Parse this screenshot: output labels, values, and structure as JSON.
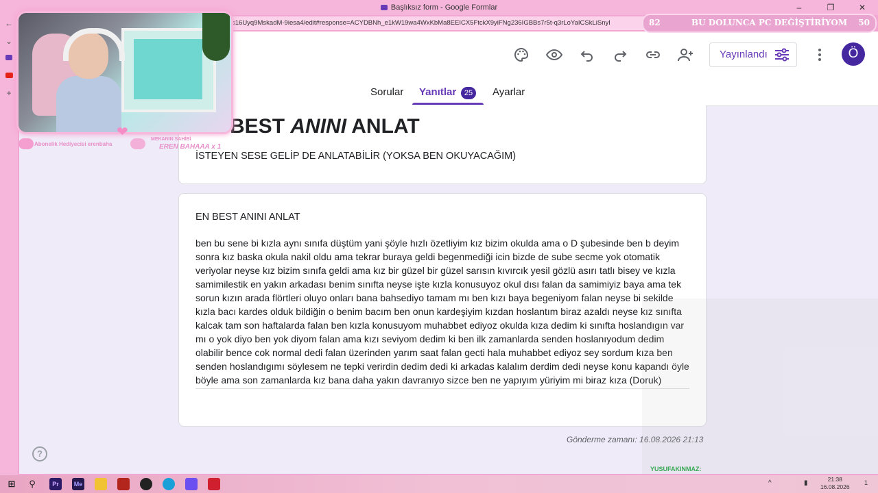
{
  "browser": {
    "window_title": "Başlıksız form - Google Formlar",
    "url": "s16Uyq9MskadM-9iesa4/edit#response=ACYDBNh_e1kW19wa4WxKbMa8EEICX5FtckX9yiFNg236IGBBs7r5t-q3rLoYaICSkLiSnyI"
  },
  "header": {
    "publish_label": "Yayınlandı",
    "avatar_letter": "Ö",
    "tabs": [
      {
        "label": "Sorular"
      },
      {
        "label": "Yanıtlar"
      },
      {
        "label": "Ayarlar"
      }
    ],
    "responses_count": "25",
    "active_tab": "Yanıtlar"
  },
  "form": {
    "title_part1": "EN BEST ",
    "title_italic": "ANINI",
    "title_part2": " ANLAT",
    "description": "İSTEYEN SESE GELİP DE ANLATABİLİR (YOKSA BEN OKUYACAĞIM)"
  },
  "response": {
    "question": "EN BEST ANINI ANLAT",
    "answer": "ben bu sene bi kızla aynı sınıfa düştüm yani şöyle hızlı özetliyim kız bizim okulda ama o D şubesinde ben  b deyim sonra kız baska okula nakil oldu ama tekrar buraya geldi begenmediği icin bizde de sube secme yok otomatik veriyolar neyse kız bizim sınıfa geldi ama kız bir güzel bir güzel sarısın kıvırcık yesil gözlü asırı tatlı bisey ve kızla samimilestik en yakın arkadası benim sınıfta neyse işte kızla konusuyoz okul dısı falan da samimiyiz baya ama tek sorun kızın arada flörtleri oluyo onları bana bahsediyo tamam mı ben kızı baya begeniyom falan neyse bi sekilde kızla bacı kardes olduk bildiğin o benim bacım ben onun kardeşiyim  kızdan hoslantım biraz azaldı neyse kız sınıfta kalcak tam son  haftalarda falan ben kızla konusuyom muhabbet ediyoz okulda kıza dedim ki sınıfta hoslandıgın var mı o yok diyo ben yok diyom falan ama kızı seviyom dedim ki ben ilk zamanlarda senden hoslanıyodum dedim olabilir bence cok normal dedi falan üzerinden yarım saat falan gecti hala muhabbet ediyoz sey sordum kıza ben senden hoslandıgımı söylesem ne tepki verirdin dedim dedi ki arkadas kalalım derdim dedi neyse konu kapandı öyle böyle ama son zamanlarda kız bana daha yakın davranıyo sizce ben ne yapıyım yüriyim mi biraz kıza (Doruk)",
    "timestamp": "Gönderme zamanı: 16.08.2026 21:13"
  },
  "stream_overlay": {
    "goal_left": "82",
    "goal_text": "BU DOLUNCA PC DEĞİŞTİRİYOM",
    "goal_right": "50",
    "sub_gifter": "Abonelik Hediyecisi erenbaha",
    "owner_title": "MEKANIN SAHİBİ",
    "owner_name": "EREN BAHAAA x 1",
    "chat_user": "YUSUFAKINMAZ:"
  },
  "taskbar": {
    "time": "21:38",
    "date": "16.08.2026",
    "notification_count": "1"
  },
  "colors": {
    "accent": "#673ab7",
    "badge": "#4527a0",
    "page_bg": "#f0ebf8",
    "chrome_pink": "#f6b5da"
  }
}
